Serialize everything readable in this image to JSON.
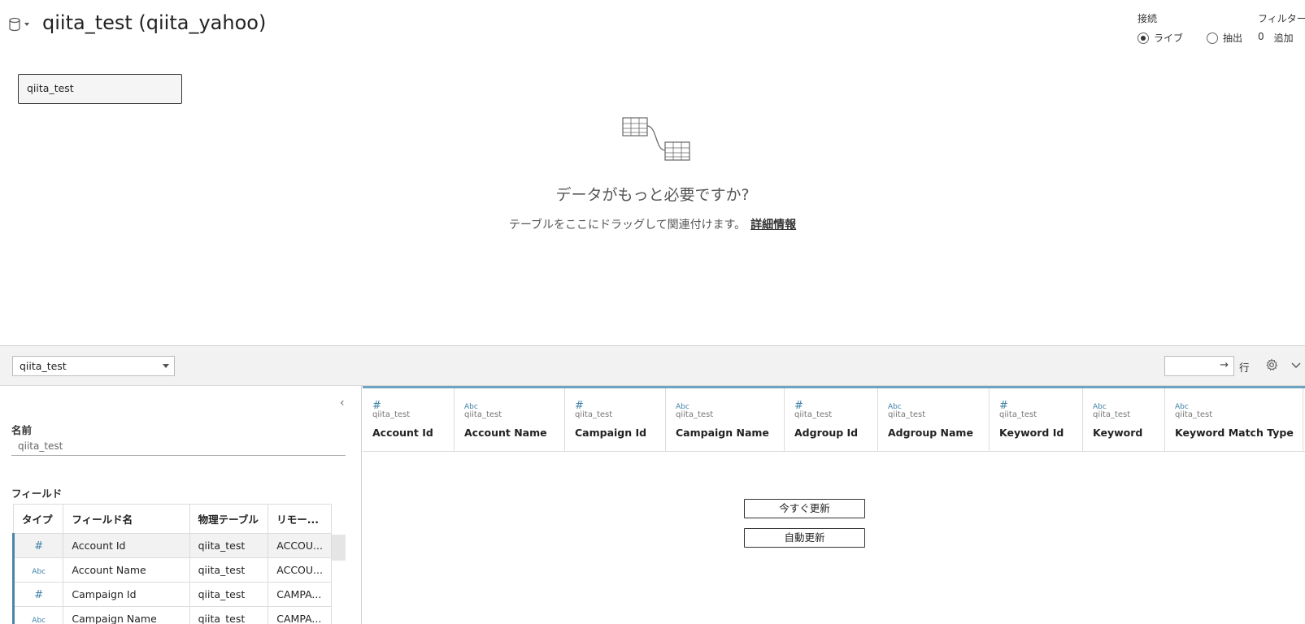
{
  "header": {
    "datasource_title": "qiita_test (qiita_yahoo)",
    "icons": {
      "datasource": "database-icon",
      "dropdown": "caret-down-icon"
    }
  },
  "connection": {
    "label": "接続",
    "options": [
      {
        "label": "ライブ",
        "selected": true
      },
      {
        "label": "抽出",
        "selected": false
      }
    ]
  },
  "filters": {
    "label": "フィルター",
    "count": "0",
    "add_label": "追加"
  },
  "canvas": {
    "table_chip": "qiita_test",
    "empty_title": "データがもっと必要ですか?",
    "empty_subtitle": "テーブルをここにドラッグして関連付けます。",
    "learn_more": "詳細情報",
    "icon": "related-tables-icon"
  },
  "toolbar": {
    "table_select": "qiita_test",
    "rows_value": "",
    "rows_label": "行",
    "icons": {
      "go": "arrow-right-icon",
      "settings": "gear-icon",
      "collapse": "chevron-down-icon"
    }
  },
  "metadata": {
    "name_label": "名前",
    "name_value": "qiita_test",
    "fields_label": "フィールド",
    "columns": [
      "タイプ",
      "フィールド名",
      "物理テーブル",
      "リモー..."
    ],
    "rows": [
      {
        "type": "number",
        "name": "Account Id",
        "table": "qiita_test",
        "remote": "ACCOU..."
      },
      {
        "type": "string",
        "name": "Account Name",
        "table": "qiita_test",
        "remote": "ACCOU..."
      },
      {
        "type": "number",
        "name": "Campaign Id",
        "table": "qiita_test",
        "remote": "CAMPA..."
      },
      {
        "type": "string",
        "name": "Campaign Name",
        "table": "qiita_test",
        "remote": "CAMPA..."
      }
    ]
  },
  "grid": {
    "columns": [
      {
        "type": "number",
        "source": "qiita_test",
        "name": "Account Id"
      },
      {
        "type": "string",
        "source": "qiita_test",
        "name": "Account Name"
      },
      {
        "type": "number",
        "source": "qiita_test",
        "name": "Campaign Id"
      },
      {
        "type": "string",
        "source": "qiita_test",
        "name": "Campaign Name"
      },
      {
        "type": "number",
        "source": "qiita_test",
        "name": "Adgroup Id"
      },
      {
        "type": "string",
        "source": "qiita_test",
        "name": "Adgroup Name"
      },
      {
        "type": "number",
        "source": "qiita_test",
        "name": "Keyword Id"
      },
      {
        "type": "string",
        "source": "qiita_test",
        "name": "Keyword"
      },
      {
        "type": "string",
        "source": "qiita_test",
        "name": "Keyword Match Type"
      }
    ],
    "update_now": "今すぐ更新",
    "auto_update": "自動更新"
  },
  "type_glyphs": {
    "number": "#",
    "string": "Abc"
  },
  "colors": {
    "accent": "#6ca5c3",
    "type_icon": "#3d7fa6"
  }
}
